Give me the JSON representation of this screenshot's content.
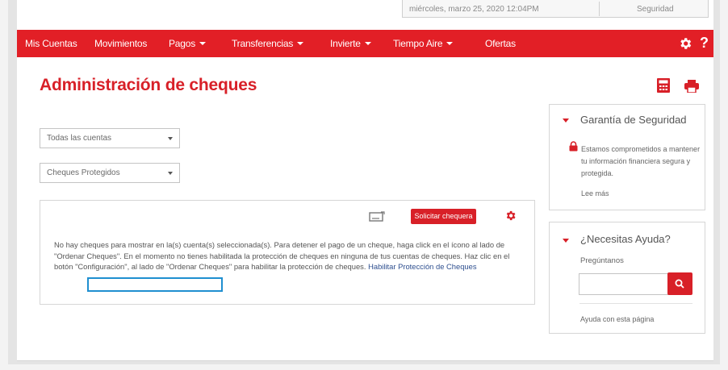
{
  "header": {
    "datetime": "miércoles, marzo 25, 2020 12:04PM",
    "security_label": "Seguridad"
  },
  "nav": {
    "items": [
      {
        "label": "Mis Cuentas",
        "dropdown": false
      },
      {
        "label": "Movimientos",
        "dropdown": false
      },
      {
        "label": "Pagos",
        "dropdown": true
      },
      {
        "label": "Transferencias",
        "dropdown": true
      },
      {
        "label": "Invierte",
        "dropdown": true
      },
      {
        "label": "Tiempo Aire",
        "dropdown": true
      },
      {
        "label": "Ofertas",
        "dropdown": false
      }
    ],
    "settings_icon": "gear-icon",
    "help_label": "?"
  },
  "main": {
    "title": "Administración de cheques",
    "calculator_icon": "calculator-icon",
    "print_icon": "printer-icon",
    "account_select": {
      "value": "Todas las cuentas"
    },
    "type_select": {
      "value": "Cheques Protegidos"
    },
    "panel": {
      "request_button": "Solicitar chequera",
      "message": "No hay cheques para mostrar en la(s) cuenta(s) seleccionada(s). Para detener el pago de un cheque, haga click en el ícono al lado de \"Ordenar Cheques\". En el momento no tienes habilitada la protección de cheques en ninguna de tus cuentas de cheques. Haz clic en el botón \"Configuración\", al lado de \"Ordenar Cheques\" para habilitar la protección de cheques.",
      "link": "Habilitar Protección de Cheques"
    }
  },
  "sidebar": {
    "security": {
      "title": "Garantía de Seguridad",
      "text": "Estamos comprometidos a mantener tu información financiera segura y protegida.",
      "link": "Lee más"
    },
    "help": {
      "title": "¿Necesitas Ayuda?",
      "label": "Pregúntanos",
      "search_placeholder": "",
      "link": "Ayuda con esta página"
    }
  },
  "colors": {
    "brand_red": "#e21f26",
    "highlight_blue": "#1f8fd0"
  }
}
